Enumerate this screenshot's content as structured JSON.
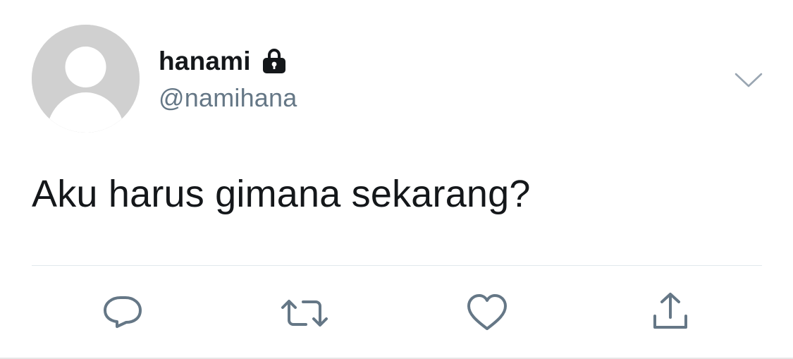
{
  "user": {
    "display_name": "hanami",
    "handle": "@namihana",
    "protected_icon": "lock-icon",
    "avatar": "default-avatar"
  },
  "tweet": {
    "text": "Aku harus gimana sekarang?"
  },
  "actions": [
    {
      "name": "reply",
      "icon": "reply-icon"
    },
    {
      "name": "retweet",
      "icon": "retweet-icon"
    },
    {
      "name": "like",
      "icon": "heart-icon"
    },
    {
      "name": "share",
      "icon": "share-icon"
    }
  ],
  "menu": {
    "icon": "chevron-down-icon"
  },
  "colors": {
    "text_primary": "#14171a",
    "text_secondary": "#657786",
    "icon": "#657786",
    "divider": "#e1e8ed",
    "avatar_bg": "#d0d0d0"
  }
}
